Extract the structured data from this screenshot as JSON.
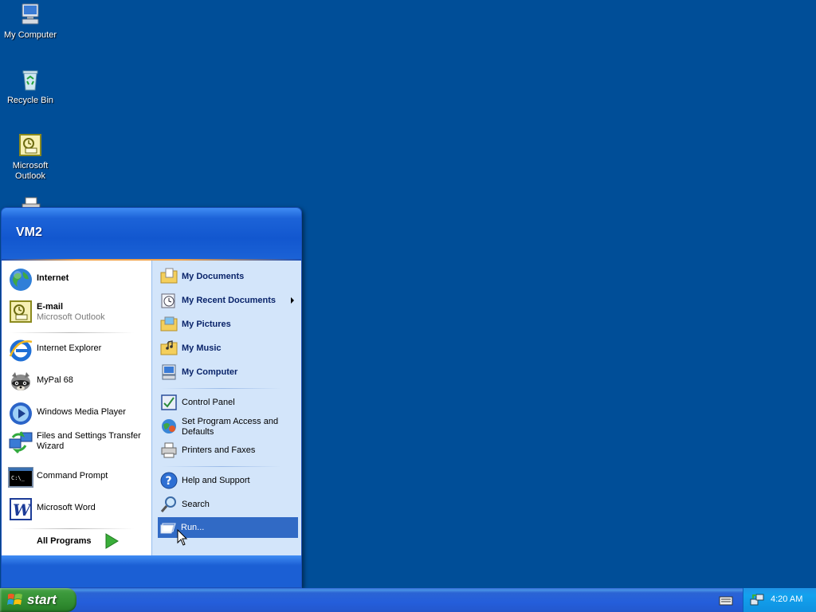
{
  "desktop": {
    "icons": [
      {
        "label": "My Computer",
        "icon": "my-computer-icon"
      },
      {
        "label": "Recycle Bin",
        "icon": "recycle-bin-icon"
      },
      {
        "label": "Microsoft Outlook",
        "icon": "outlook-icon"
      },
      {
        "label": "",
        "icon": "printer-icon"
      }
    ]
  },
  "start_menu": {
    "user": "VM2",
    "left_pinned": [
      {
        "label": "Internet",
        "icon": "globe-icon"
      },
      {
        "label": "E-mail",
        "sub": "Microsoft Outlook",
        "icon": "outlook-icon"
      }
    ],
    "left_recent": [
      {
        "label": "Internet Explorer",
        "icon": "internet-explorer-icon"
      },
      {
        "label": "MyPal 68",
        "icon": "mypal-raccoon-icon"
      },
      {
        "label": "Windows Media Player",
        "icon": "media-player-icon"
      },
      {
        "label": "Files and Settings Transfer Wizard",
        "icon": "transfer-wizard-icon"
      },
      {
        "label": "Command Prompt",
        "icon": "command-prompt-icon"
      },
      {
        "label": "Microsoft Word",
        "icon": "word-icon"
      }
    ],
    "all_programs": "All Programs",
    "right_places": [
      {
        "label": "My Documents",
        "icon": "folder-documents-icon"
      },
      {
        "label": "My Recent Documents",
        "icon": "recent-documents-icon",
        "submenu": true
      },
      {
        "label": "My Pictures",
        "icon": "folder-pictures-icon"
      },
      {
        "label": "My Music",
        "icon": "folder-music-icon"
      },
      {
        "label": "My Computer",
        "icon": "my-computer-icon"
      }
    ],
    "right_settings": [
      {
        "label": "Control Panel",
        "icon": "control-panel-icon"
      },
      {
        "label": "Set Program Access and Defaults",
        "icon": "program-access-icon"
      },
      {
        "label": "Printers and Faxes",
        "icon": "printer-icon"
      }
    ],
    "right_tools": [
      {
        "label": "Help and Support",
        "icon": "help-icon"
      },
      {
        "label": "Search",
        "icon": "search-icon"
      },
      {
        "label": "Run...",
        "icon": "run-icon",
        "highlighted": true
      }
    ]
  },
  "taskbar": {
    "start_label": "start",
    "clock": "4:20 AM",
    "tray_icons": [
      "keyboard-icon",
      "network-icon"
    ]
  },
  "colors": {
    "desktop": "#004e98",
    "highlight": "#316ac5",
    "start_green": "#3c9a3c"
  }
}
